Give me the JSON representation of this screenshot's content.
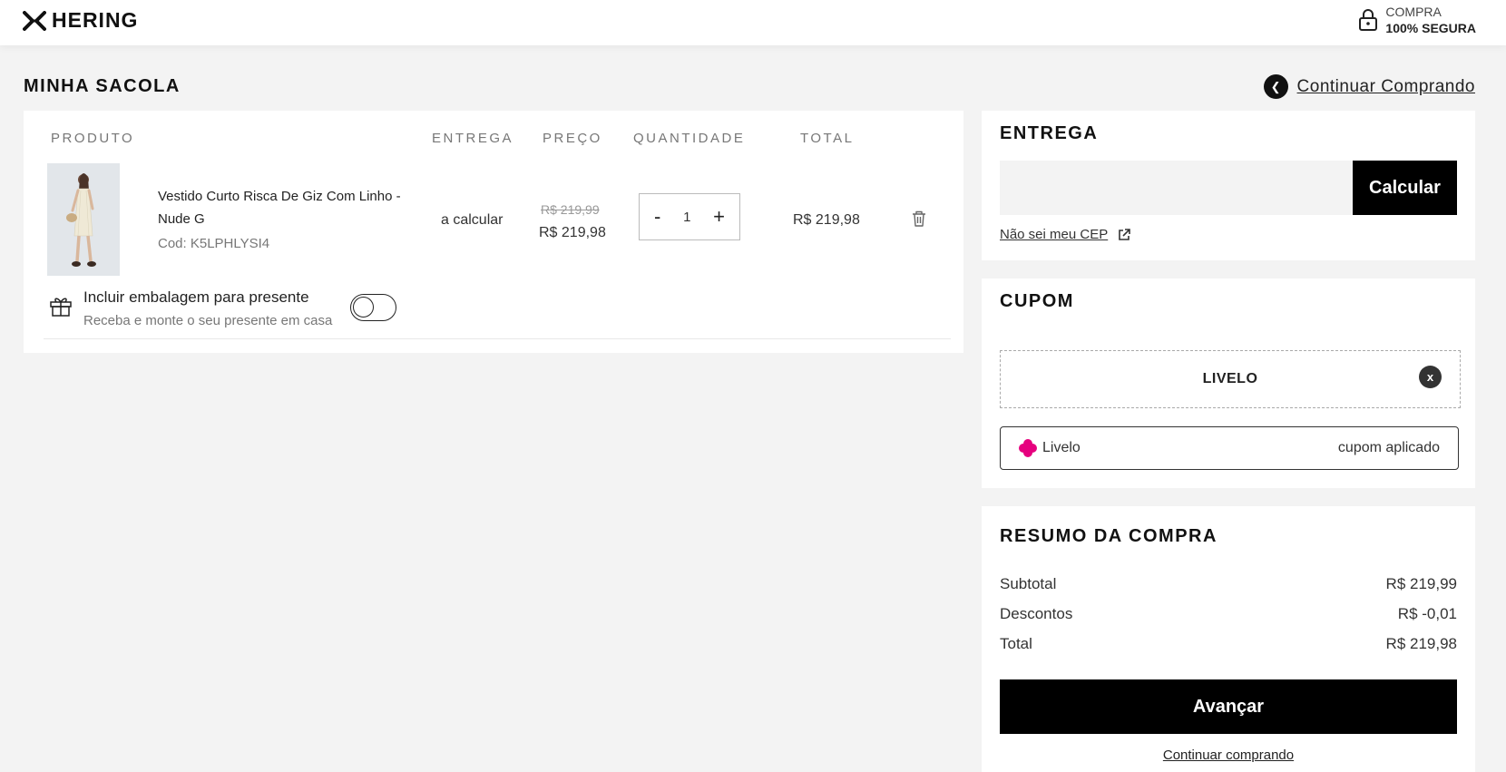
{
  "header": {
    "brand": "HERING",
    "logo_icon": "hering-x-logo",
    "secure_line1": "COMPRA",
    "secure_line2": "100% SEGURA",
    "secure_icon": "lock-icon"
  },
  "page": {
    "title": "MINHA SACOLA",
    "continue_label": "Continuar Comprando",
    "continue_icon": "chevron-left-icon"
  },
  "cart": {
    "columns": {
      "product": "PRODUTO",
      "delivery": "ENTREGA",
      "price": "PREÇO",
      "quantity": "QUANTIDADE",
      "total": "TOTAL"
    },
    "items": [
      {
        "name": "Vestido Curto Risca De Giz Com Linho - Nude G",
        "code": "Cod: K5LPHLYSI4",
        "delivery": "a calcular",
        "price_old": "R$ 219,99",
        "price_new": "R$ 219,98",
        "qty_minus": "-",
        "quantity": "1",
        "qty_plus": "+",
        "total": "R$ 219,98",
        "image": "dress-product-photo"
      }
    ],
    "gift": {
      "title": "Incluir embalagem para presente",
      "subtitle": "Receba e monte o seu presente em casa",
      "enabled": false
    }
  },
  "delivery": {
    "title": "ENTREGA",
    "cep_placeholder": "",
    "calculate_label": "Calcular",
    "unknown_cep_label": "Não sei meu CEP"
  },
  "coupon": {
    "title": "CUPOM",
    "code": "LIVELO",
    "remove_label": "x",
    "applied_name": "Livelo",
    "applied_status": "cupom aplicado"
  },
  "summary": {
    "title": "RESUMO DA COMPRA",
    "rows": [
      {
        "label": "Subtotal",
        "value": "R$ 219,99"
      },
      {
        "label": "Descontos",
        "value": "R$ -0,01"
      },
      {
        "label": "Total",
        "value": "R$ 219,98"
      }
    ],
    "advance_label": "Avançar",
    "continue_label": "Continuar comprando"
  },
  "colors": {
    "primary": "#000000",
    "background": "#f3f3f3",
    "livelo": "#e6007e"
  }
}
